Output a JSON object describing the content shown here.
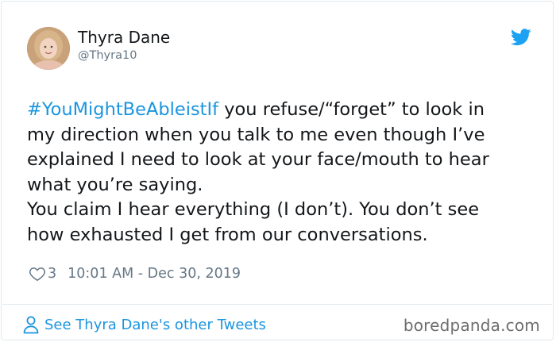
{
  "author": {
    "name": "Thyra Dane",
    "handle": "@Thyra10",
    "avatar_icon": "profile-photo"
  },
  "tweet": {
    "hashtag": "#YouMightBeAbleistIf",
    "line1_rest": " you refuse/“forget” to look in",
    "line2": "my direction when you talk to me even though I’ve",
    "line3": "explained I need to look at your face/mouth to hear",
    "line4": "what you’re saying.",
    "line5": "You claim I hear everything (I don’t). You don’t see",
    "line6": "how exhausted I get from our conversations."
  },
  "meta": {
    "like_count": "3",
    "timestamp": "10:01 AM - Dec 30, 2019"
  },
  "footer": {
    "see_more_label": "See Thyra Dane's other Tweets",
    "watermark": "boredpanda.com"
  },
  "colors": {
    "link": "#1b95e0",
    "muted": "#657786",
    "text": "#14171a",
    "border": "#e1e8ed"
  },
  "icons": {
    "brand": "twitter-bird-icon",
    "like": "heart-icon",
    "profile": "person-icon"
  }
}
